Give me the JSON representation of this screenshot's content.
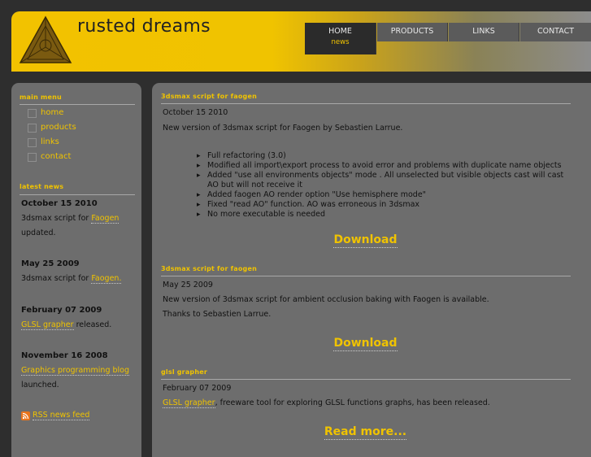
{
  "site": {
    "title": "rusted dreams"
  },
  "nav": [
    {
      "label": "HOME",
      "sub": "news"
    },
    {
      "label": "PRODUCTS"
    },
    {
      "label": "LINKS"
    },
    {
      "label": "CONTACT"
    }
  ],
  "sidebar": {
    "menu_title": "main menu",
    "menu": [
      "home",
      "products",
      "links",
      "contact"
    ],
    "news_title": "latest news",
    "news": [
      {
        "date": "October 15 2010",
        "pre": "3dsmax script for ",
        "link": "Faogen",
        "post": "",
        "line2": "updated."
      },
      {
        "date": "May 25 2009",
        "pre": "3dsmax script for ",
        "link": "Faogen.",
        "post": ""
      },
      {
        "date": "February 07 2009",
        "pre": "",
        "link": "GLSL grapher",
        "post": " released."
      },
      {
        "date": "November 16 2008",
        "link": "Graphics programming blog",
        "line2": "launched."
      }
    ],
    "rss": "RSS news feed",
    "rss_icon": "rss-icon"
  },
  "articles": [
    {
      "title": "3dsmax script for faogen",
      "date": "October 15 2010",
      "text": "New version of 3dsmax script for Faogen by Sebastien Larrue.",
      "bullets": [
        "Full refactoring (3.0)",
        "Modified all import\\export process to avoid error and problems with duplicate name objects",
        "Added \"use all environments objects\" mode . All unselected but visible objects cast will cast AO but will not receive it",
        "Added faogen AO render option \"Use hemisphere mode\"",
        "Fixed \"read AO\" function. AO was erroneous in 3dsmax",
        "No more executable is needed"
      ],
      "link": "Download"
    },
    {
      "title": "3dsmax script for faogen",
      "date": "May 25 2009",
      "text": "New version of 3dsmax script for ambient occlusion baking with Faogen is available.",
      "text2": "Thanks to Sebastien Larrue.",
      "link": "Download"
    },
    {
      "title": "glsl grapher",
      "date": "February 07 2009",
      "link_inline": "GLSL grapher",
      "text_after": ", freeware tool for exploring GLSL functions graphs, has been released.",
      "link": "Read more..."
    }
  ]
}
